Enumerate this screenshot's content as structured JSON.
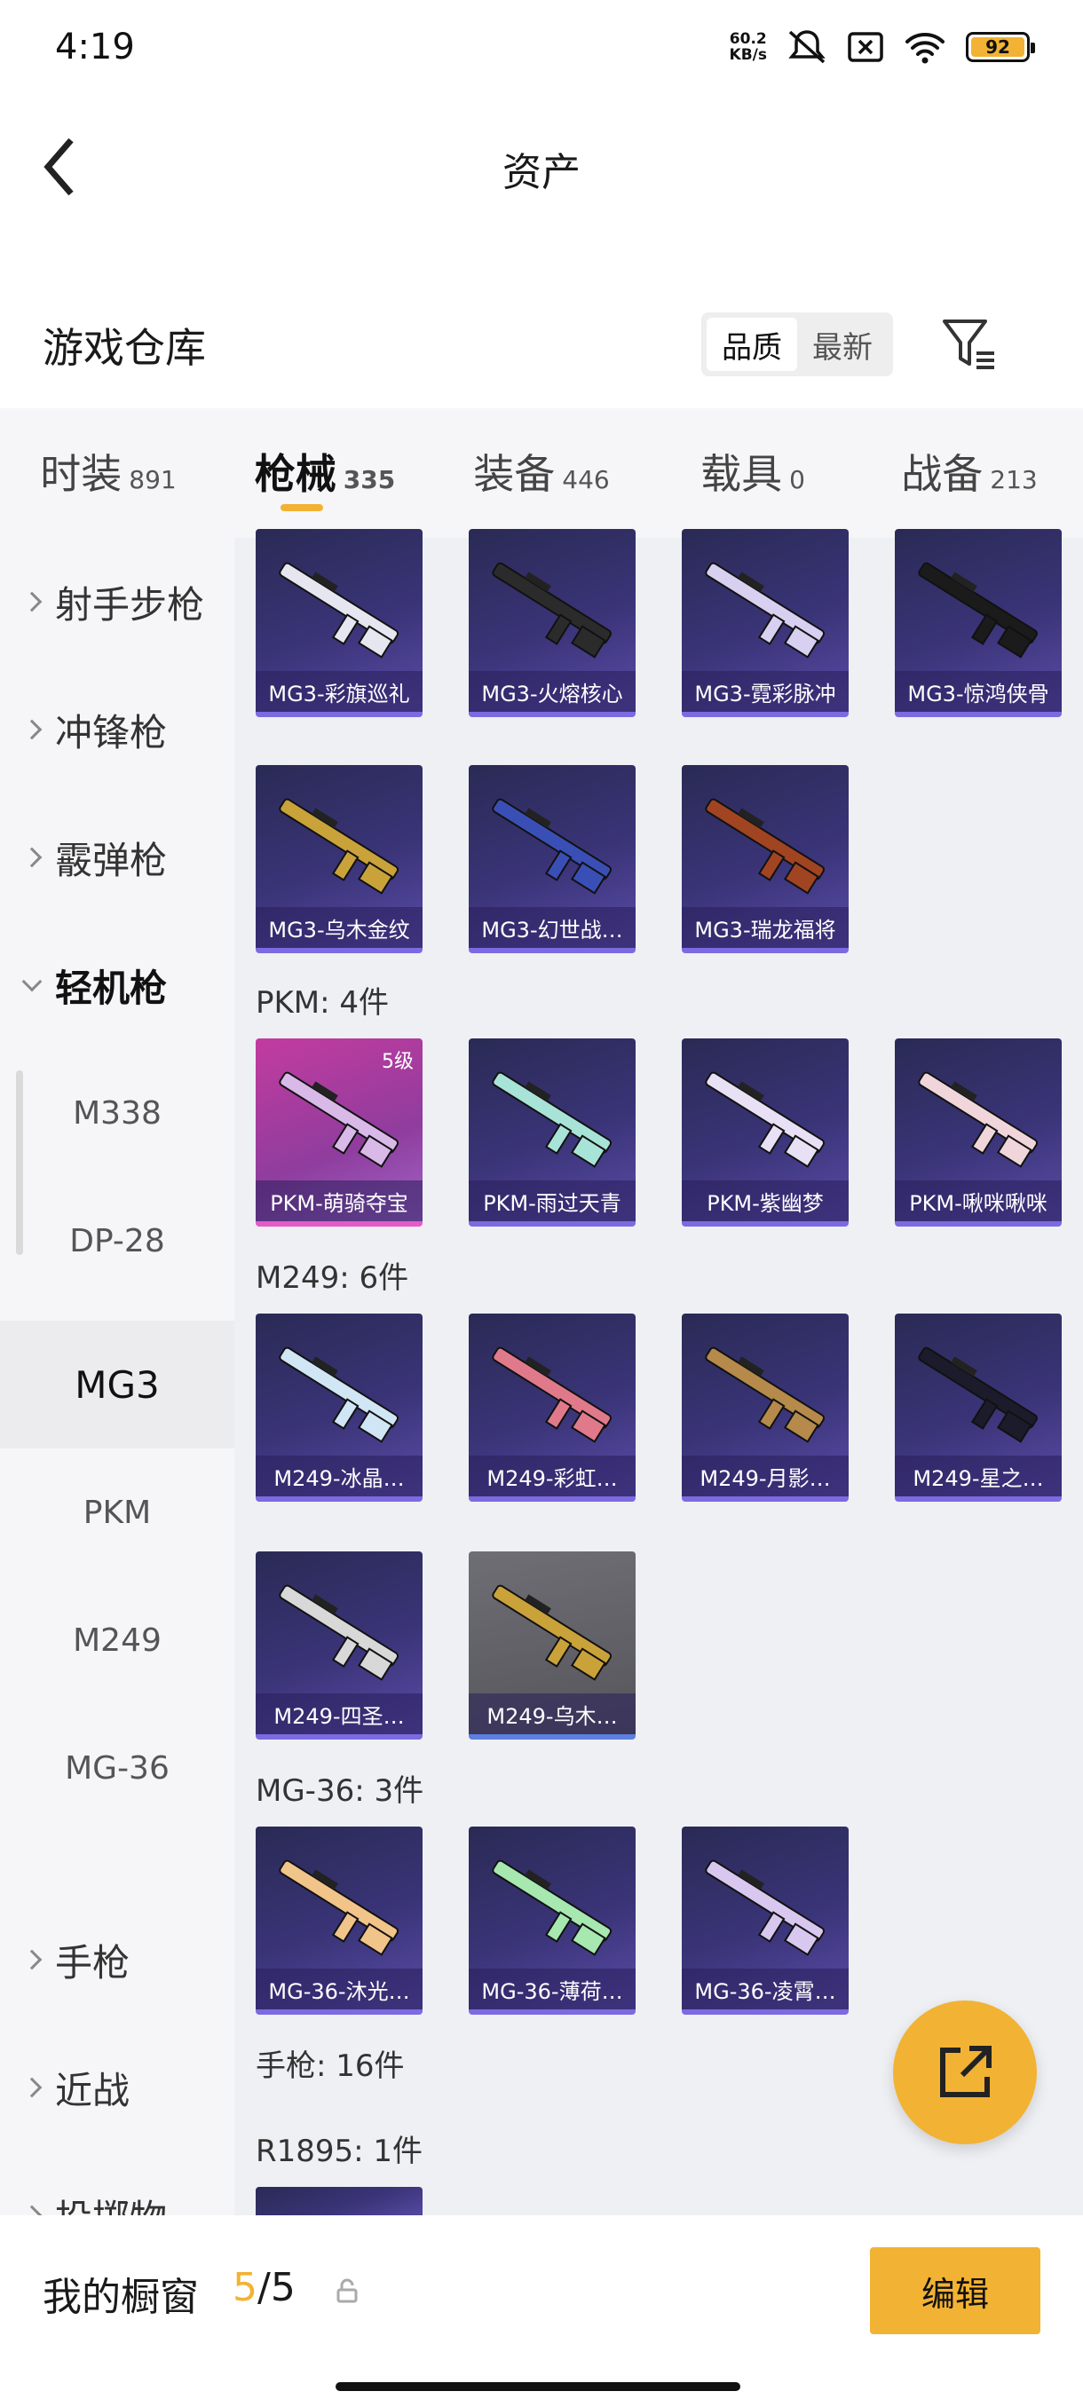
{
  "status": {
    "time": "4:19",
    "netspeed_value": "60.2",
    "netspeed_unit": "KB/s",
    "battery": "92"
  },
  "header": {
    "title": "资产"
  },
  "section": {
    "title": "游戏仓库",
    "sort_options": [
      "品质",
      "最新"
    ]
  },
  "tabs": [
    {
      "label": "时装",
      "count": "891"
    },
    {
      "label": "枪械",
      "count": "335"
    },
    {
      "label": "装备",
      "count": "446"
    },
    {
      "label": "载具",
      "count": "0"
    },
    {
      "label": "战备",
      "count": "213"
    }
  ],
  "sidebar": {
    "categories": [
      "射手步枪",
      "冲锋枪",
      "霰弹枪",
      "轻机枪",
      "手枪",
      "近战",
      "投掷物"
    ],
    "subitems": [
      "M338",
      "DP-28",
      "MG3",
      "PKM",
      "M249",
      "MG-36"
    ],
    "selected": "MG3"
  },
  "groups": {
    "mg3_items": [
      "MG3-彩旗巡礼",
      "MG3-火熔核心",
      "MG3-霓彩脉冲",
      "MG3-惊鸿侠骨",
      "MG3-乌木金纹",
      "MG3-幻世战…",
      "MG3-瑞龙福将"
    ],
    "pkm_header": "PKM: 4件",
    "pkm_items": [
      "PKM-萌骑夺宝",
      "PKM-雨过天青",
      "PKM-紫幽梦",
      "PKM-啾咪啾咪"
    ],
    "pkm_level": "5级",
    "m249_header": "M249: 6件",
    "m249_items": [
      "M249-冰晶…",
      "M249-彩虹…",
      "M249-月影…",
      "M249-星之…",
      "M249-四圣…",
      "M249-乌木…"
    ],
    "mg36_header": "MG-36: 3件",
    "mg36_items": [
      "MG-36-沐光…",
      "MG-36-薄荷…",
      "MG-36-凌霄…"
    ],
    "pistol_header": "手枪: 16件",
    "r1895_header": "R1895: 1件"
  },
  "bottombar": {
    "label": "我的橱窗",
    "current": "5",
    "total": "/5",
    "edit_label": "编辑"
  },
  "colors": {
    "accent": "#f2b233",
    "card_purple": "#3a3478",
    "card_pink": "#c33b9f",
    "card_grey": "#6e6e74"
  }
}
